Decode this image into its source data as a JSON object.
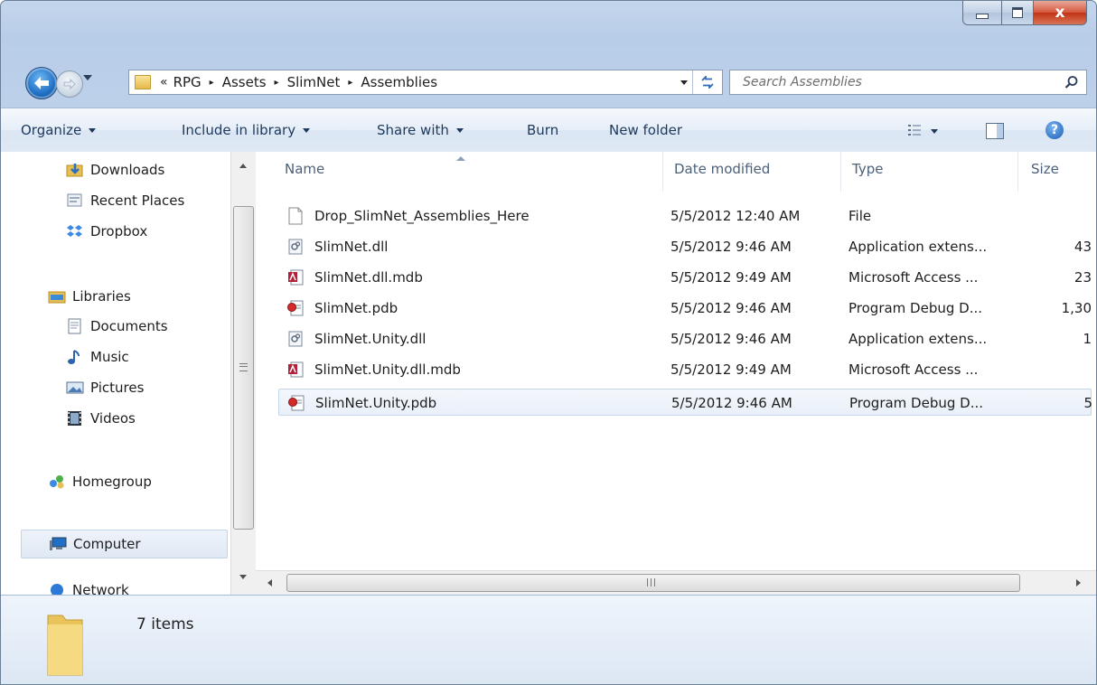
{
  "window": {
    "close_glyph": "x"
  },
  "navigation": {
    "breadcrumb_chevron": "«",
    "breadcrumb": [
      "RPG",
      "Assets",
      "SlimNet",
      "Assemblies"
    ],
    "separator_glyph": "▸",
    "search": {
      "placeholder": "Search Assemblies"
    }
  },
  "toolbar": {
    "organize": "Organize",
    "include_in_library": "Include in library",
    "share_with": "Share with",
    "burn": "Burn",
    "new_folder": "New folder",
    "help_glyph": "?"
  },
  "nav_pane": {
    "favorites": [
      {
        "label": "Downloads",
        "icon": "downloads-folder-icon"
      },
      {
        "label": "Recent Places",
        "icon": "recent-places-icon"
      },
      {
        "label": "Dropbox",
        "icon": "dropbox-icon"
      }
    ],
    "libraries": {
      "label": "Libraries",
      "items": [
        {
          "label": "Documents",
          "icon": "documents-icon"
        },
        {
          "label": "Music",
          "icon": "music-icon"
        },
        {
          "label": "Pictures",
          "icon": "pictures-icon"
        },
        {
          "label": "Videos",
          "icon": "videos-icon"
        }
      ]
    },
    "homegroup": "Homegroup",
    "computer": "Computer",
    "network": "Network"
  },
  "file_list": {
    "columns": {
      "name": "Name",
      "date": "Date modified",
      "type": "Type",
      "size": "Size"
    },
    "files": [
      {
        "name": "Drop_SlimNet_Assemblies_Here",
        "date": "5/5/2012 12:40 AM",
        "type": "File",
        "size": "",
        "icon": "blank-file-icon"
      },
      {
        "name": "SlimNet.dll",
        "date": "5/5/2012 9:46 AM",
        "type": "Application extens...",
        "size": "43",
        "icon": "dll-file-icon"
      },
      {
        "name": "SlimNet.dll.mdb",
        "date": "5/5/2012 9:49 AM",
        "type": "Microsoft Access ...",
        "size": "23",
        "icon": "access-file-icon"
      },
      {
        "name": "SlimNet.pdb",
        "date": "5/5/2012 9:46 AM",
        "type": "Program Debug D...",
        "size": "1,30",
        "icon": "pdb-file-icon"
      },
      {
        "name": "SlimNet.Unity.dll",
        "date": "5/5/2012 9:46 AM",
        "type": "Application extens...",
        "size": "1",
        "icon": "dll-file-icon"
      },
      {
        "name": "SlimNet.Unity.dll.mdb",
        "date": "5/5/2012 9:49 AM",
        "type": "Microsoft Access ...",
        "size": "",
        "icon": "access-file-icon"
      },
      {
        "name": "SlimNet.Unity.pdb",
        "date": "5/5/2012 9:46 AM",
        "type": "Program Debug D...",
        "size": "5",
        "icon": "pdb-file-icon"
      }
    ]
  },
  "status": {
    "item_count": "7 items"
  },
  "colors": {
    "accent": "#1e395b",
    "selection": "#e9f0f9",
    "chrome": "#bcd0ea"
  }
}
